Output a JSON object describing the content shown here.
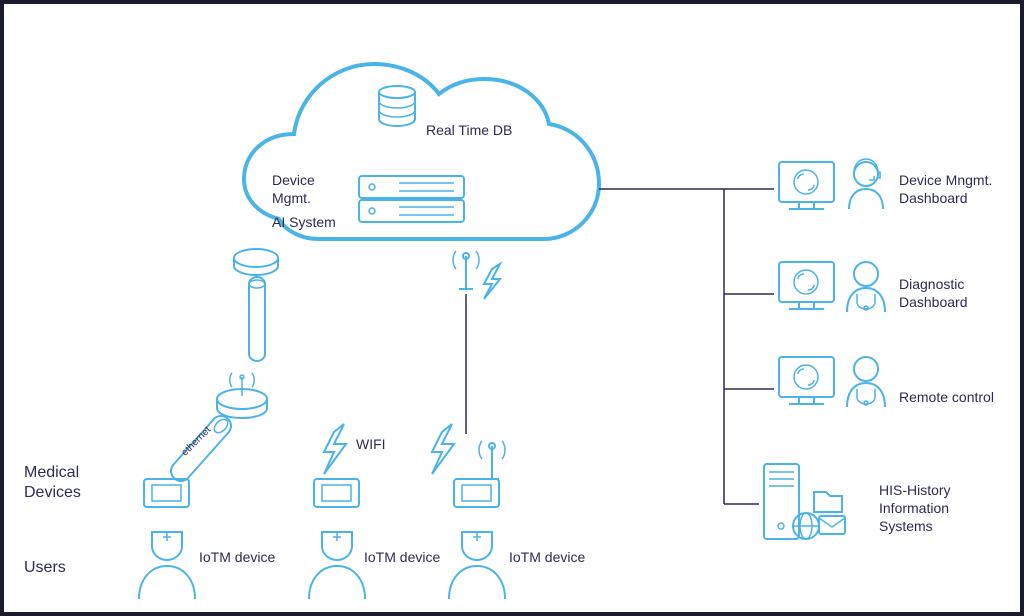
{
  "diagram": {
    "cloud": {
      "db_label": "Real Time DB",
      "device_mgmt_label_1": "Device",
      "device_mgmt_label_2": "Mgmt.",
      "ai_label": "AI System"
    },
    "left_section": {
      "medical_devices_label": "Medical",
      "medical_devices_label_2": "Devices",
      "users_label": "Users",
      "ethernet_label": "ethernet",
      "wifi_label": "WIFI",
      "iotm_1": "IoTM device",
      "iotm_2": "IoTM device",
      "iotm_3": "IoTM device"
    },
    "right_section": {
      "device_mgmt_1": "Device Mngmt.",
      "device_mgmt_2": "Dashboard",
      "diagnostic_1": "Diagnostic",
      "diagnostic_2": "Dashboard",
      "remote_control": "Remote control",
      "his_1": "HIS-History",
      "his_2": "Information",
      "his_3": "Systems"
    }
  }
}
